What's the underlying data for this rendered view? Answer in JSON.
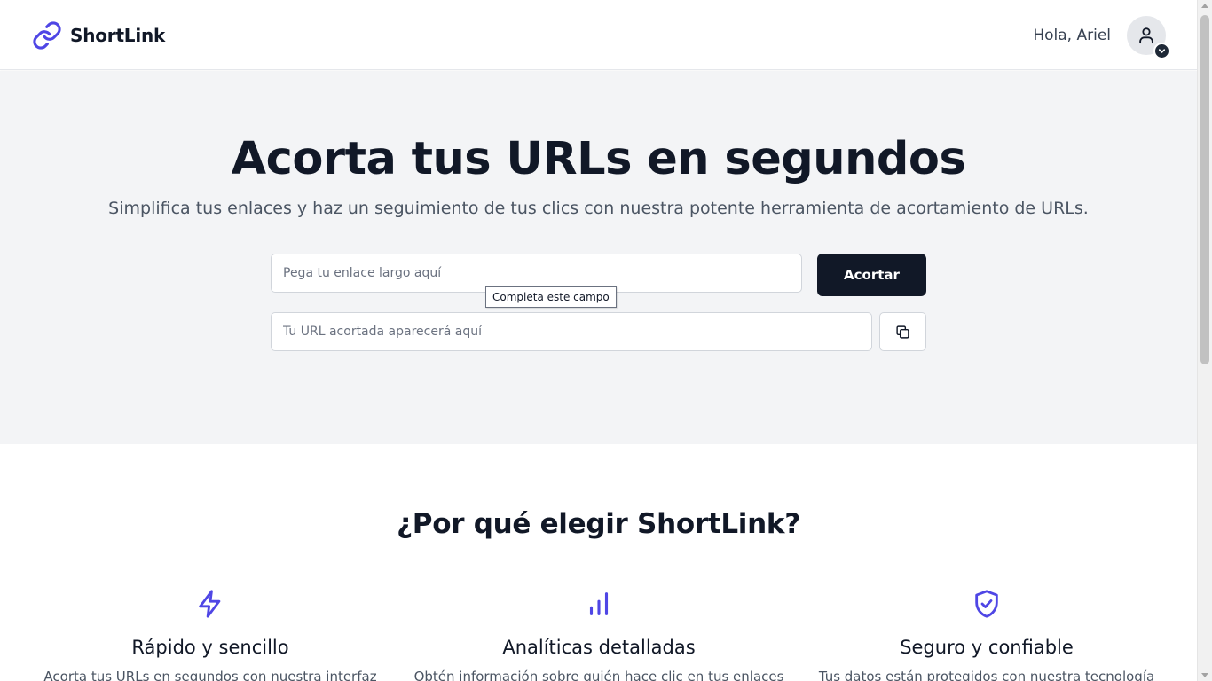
{
  "header": {
    "brand_name": "ShortLink",
    "logo_icon": "link-icon",
    "greeting": "Hola, Ariel",
    "avatar_icon": "user-icon",
    "avatar_menu_icon": "chevron-down-icon"
  },
  "hero": {
    "title": "Acorta tus URLs en segundos",
    "subtitle": "Simplifica tus enlaces y haz un seguimiento de tus clics con nuestra potente herramienta de acortamiento de URLs.",
    "url_input_placeholder": "Pega tu enlace largo aquí",
    "shorten_button_label": "Acortar",
    "validation_tooltip": "Completa este campo",
    "result_input_placeholder": "Tu URL acortada aparecerá aquí",
    "copy_icon": "copy-icon"
  },
  "features": {
    "title": "¿Por qué elegir ShortLink?",
    "items": [
      {
        "icon": "lightning-icon",
        "title": "Rápido y sencillo",
        "description": "Acorta tus URLs en segundos con nuestra interfaz"
      },
      {
        "icon": "bar-chart-icon",
        "title": "Analíticas detalladas",
        "description": "Obtén información sobre quién hace clic en tus enlaces"
      },
      {
        "icon": "shield-check-icon",
        "title": "Seguro y confiable",
        "description": "Tus datos están protegidos con nuestra tecnología"
      }
    ]
  },
  "colors": {
    "accent": "#4f46e5",
    "dark": "#111827",
    "hero_background": "#f3f4f6"
  }
}
